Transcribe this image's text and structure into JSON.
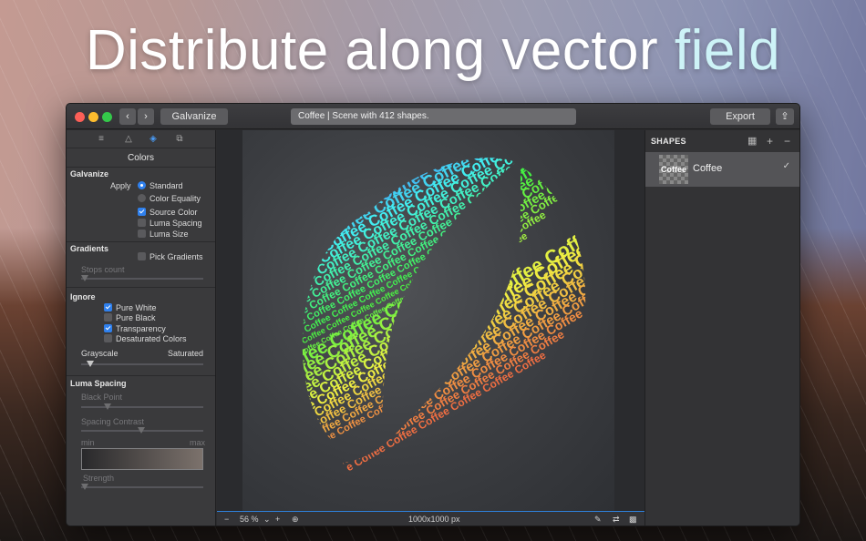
{
  "headline": {
    "main": "Distribute along vector ",
    "accent": "field"
  },
  "toolbar": {
    "back": "‹",
    "forward": "›",
    "galvanize": "Galvanize",
    "doc_title": "Coffee | Scene with 412 shapes.",
    "export": "Export",
    "share": "⇪"
  },
  "left_panel": {
    "title": "Colors",
    "galvanize": {
      "heading": "Galvanize",
      "apply_label": "Apply",
      "standard": "Standard",
      "color_equality": "Color Equality",
      "source_color": "Source Color",
      "luma_spacing": "Luma Spacing",
      "luma_size": "Luma Size"
    },
    "gradients": {
      "heading": "Gradients",
      "pick": "Pick Gradients",
      "stops_count": "Stops count"
    },
    "ignore": {
      "heading": "Ignore",
      "pure_white": "Pure White",
      "pure_black": "Pure Black",
      "transparency": "Transparency",
      "desaturated": "Desaturated Colors",
      "grayscale": "Grayscale",
      "saturated": "Saturated"
    },
    "luma": {
      "heading": "Luma Spacing",
      "black_point": "Black Point",
      "spacing_contrast": "Spacing Contrast",
      "min": "min",
      "max": "max",
      "strength": "Strength"
    }
  },
  "canvas": {
    "word": "Coffee"
  },
  "status_bar": {
    "minus": "−",
    "zoom": "56 %",
    "plus": "+",
    "size": "1000x1000 px"
  },
  "right_panel": {
    "heading": "SHAPES",
    "add": "+",
    "remove": "−",
    "item_thumb": "Coffee",
    "item_name": "Coffee",
    "item_check": "✓"
  }
}
